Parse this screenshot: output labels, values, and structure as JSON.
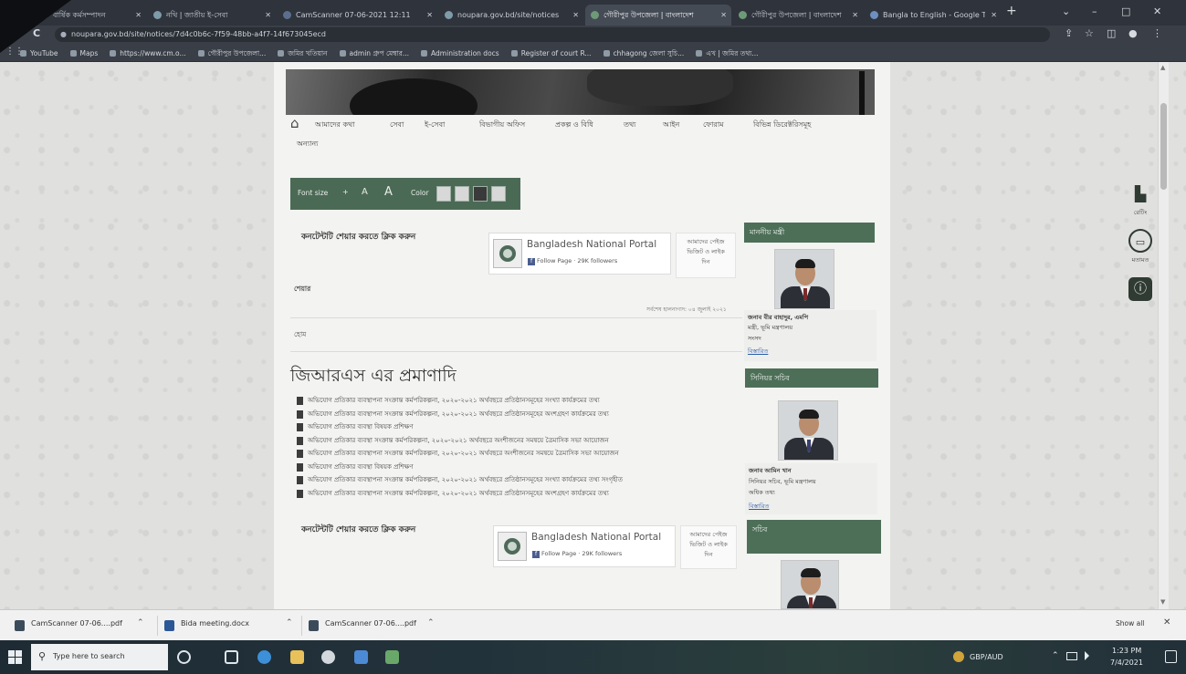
{
  "colors": {
    "accent": "#4b6a55",
    "tabbar": "#2f343c",
    "taskbar": "#223039",
    "sidebar_header": "#4d6f58"
  },
  "icons": {
    "close": "✕",
    "new_tab": "+",
    "chevron": "⌄",
    "minimize": "–",
    "maximize": "□",
    "back": "←",
    "reload": "C",
    "lock": "●",
    "share": "⇪",
    "star": "☆",
    "extensions": "◫",
    "profile": "●",
    "menu": "⋮",
    "apps": "⋮⋮",
    "home": "⌂",
    "caret_up": "⌃",
    "rating": "▙",
    "chat": "▭",
    "info": "ⓘ",
    "search": "⚲",
    "scroll_up": "▲",
    "scroll_down": "▼"
  },
  "browser": {
    "tabs": [
      {
        "label": "বার্ষিক কর্মসম্পাদন"
      },
      {
        "label": "নথি | জাতীয় ই-সেবা"
      },
      {
        "label": "CamScanner 07-06-2021 12:11"
      },
      {
        "label": "noupara.gov.bd/site/notices"
      },
      {
        "label": "গৌরীপুর উপজেলা | বাংলাদেশ"
      },
      {
        "label": "গৌরীপুর উপজেলা | বাংলাদেশ"
      },
      {
        "label": "Bangla to English - Google Tr"
      }
    ],
    "address": "noupara.gov.bd/site/notices/7d4c0b6c-7f59-48bb-a4f7-14f673045ecd",
    "bookmarks": [
      "YouTube",
      "Maps",
      "https://www.cm.o...",
      "গৌরীপুর উপজেলা...",
      "জমির খতিয়ান",
      "admin গ্রুপ মেম্বার...",
      "Administration docs",
      "Register of court R...",
      "chhagong জেলা সুচি...",
      "এখ | জমির তথ্য..."
    ]
  },
  "site": {
    "nav": {
      "items": [
        "আমাদের কথা",
        "সেবা",
        "ই-সেবা",
        "বিভাগীয় অফিস",
        "প্রকল্প ও বিধি",
        "তথ্য",
        "আইন",
        "ফোরাম",
        "বিভিন্ন ডিরেক্টরিসমূহ",
        "অন্যান্য"
      ]
    },
    "accessibility": {
      "font_size_label": "Font size",
      "font_options": [
        "+",
        "A",
        "A"
      ],
      "color_label": "Color",
      "swatches": [
        "#d8d8d8",
        "#d8d8d8",
        "#3a3a3a",
        "#d8d8d8"
      ]
    },
    "share_prompt": "কনটেন্টটি শেয়ার করতে ক্লিক করুন",
    "facebook": {
      "page_name": "Bangladesh National Portal",
      "follow_label": "Follow Page",
      "followers": "29K followers",
      "note_lines": [
        "আমাদের পেইজ",
        "ভিজিট ও লাইক",
        "দিন"
      ]
    },
    "share_small": "শেয়ার",
    "last_updated": "সর্বশেষ হালনাগাদ: ০৪ জুলাই ২০২১",
    "breadcrumb_small": "হোম",
    "heading": "জিআরএস এর প্রমাণাদি",
    "documents": [
      "অভিযোগ প্রতিকার ব্যবস্থাপনা সংক্রান্ত কর্মপরিকল্পনা, ২০২০-২০২১ অর্থবছরে প্রতিষ্ঠানসমূহের সংখ্যা কার্যক্রমের তথ্য",
      "অভিযোগ প্রতিকার ব্যবস্থাপনা সংক্রান্ত কর্মপরিকল্পনা, ২০২০-২০২১ অর্থবছরে প্রতিষ্ঠানসমূহের অংশগ্রহণ কার্যক্রমের তথ্য",
      "অভিযোগ প্রতিকার ব্যবস্থা বিষয়ক প্রশিক্ষণ",
      "অভিযোগ প্রতিকার ব্যবস্থা সংক্রান্ত কর্মপরিকল্পনা, ২০২০-২০২১ অর্থবছরে অংশীজনের সমন্বয়ে ত্রৈমাসিক সভা আয়োজন",
      "অভিযোগ প্রতিকার ব্যবস্থাপনা সংক্রান্ত কর্মপরিকল্পনা, ২০২০-২০২১ অর্থবছরে অংশীজনের সমন্বয়ে ত্রৈমাসিক সভা আয়োজন",
      "অভিযোগ প্রতিকার ব্যবস্থা বিষয়ক প্রশিক্ষণ",
      "অভিযোগ প্রতিকার ব্যবস্থাপনা সংক্রান্ত কর্মপরিকল্পনা, ২০২০-২০২১ অর্থবছরে প্রতিষ্ঠানসমূহের সংখ্যা কার্যক্রমের তথ্য সংগৃহীত",
      "অভিযোগ প্রতিকার ব্যবস্থাপনা সংক্রান্ত কর্মপরিকল্পনা, ২০২০-২০২১ অর্থবছরে প্রতিষ্ঠানসমূহের অংশগ্রহণ কার্যক্রমের তথ্য"
    ],
    "sidebar": [
      {
        "header": "মাননীয় মন্ত্রী",
        "name": "জনাব বীর বাহাদুর, এমপি",
        "title": "মন্ত্রী, ভূমি মন্ত্রণালয়",
        "extra": "সংসদ",
        "link": "বিস্তারিত"
      },
      {
        "header": "সিনিয়র সচিব",
        "name": "জনাব আমিন খান",
        "title": "সিনিয়র সচিব, ভূমি মন্ত্রণালয়",
        "extra": "অধিক তথ্য",
        "link": "বিস্তারিত"
      },
      {
        "header": "সচিব"
      }
    ],
    "floating": {
      "rating_label": "রেটিং",
      "feedback_label": "মতামত"
    }
  },
  "downloads": {
    "items": [
      "CamScanner 07-06....pdf",
      "Bida meeting.docx",
      "CamScanner 07-06....pdf"
    ],
    "show_all": "Show all"
  },
  "taskbar": {
    "search_placeholder": "Type here to search",
    "ticker": "GBP/AUD",
    "time": "1:23 PM",
    "date": "7/4/2021"
  }
}
